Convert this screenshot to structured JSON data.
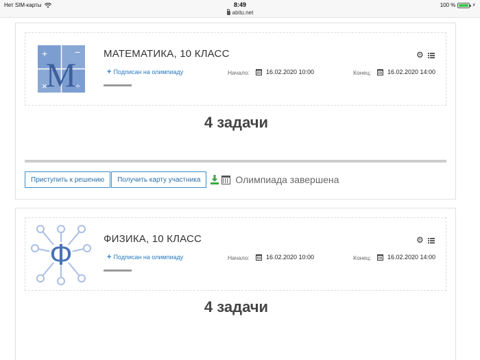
{
  "status_bar": {
    "carrier": "Нет SIM-карты",
    "time": "8:49",
    "url": "abitu.net",
    "battery": "100 %",
    "battery_level": 1.0
  },
  "olympiads": [
    {
      "title": "МАТЕМАТИКА, 10 КЛАСС",
      "subscribed": "Подписан на олимпиаду",
      "start_label": "Начало:",
      "start_value": "16.02.2020 10:00",
      "end_label": "Конец:",
      "end_value": "16.02.2020 14:00",
      "tasks": "4 задачи",
      "thumb_letter": "M",
      "start_button": "Приступить к решению",
      "card_button": "Получить карту участника",
      "status": "Олимпиада завершена"
    },
    {
      "title": "ФИЗИКА, 10 КЛАСС",
      "subscribed": "Подписан на олимпиаду",
      "start_label": "Начало:",
      "start_value": "16.02.2020 10:00",
      "end_label": "Конец:",
      "end_value": "16.02.2020 14:00",
      "tasks": "4 задачи",
      "thumb_letter": "Ф"
    }
  ],
  "colors": {
    "link": "#2a7bbf",
    "button_border": "#3a8cc9",
    "math_thumb": "#7fa0d0",
    "physics_thumb": "#a9bfe3",
    "download_icon": "#3aa845"
  },
  "icons": [
    "wifi-icon",
    "lock-icon",
    "battery-icon",
    "plus-icon",
    "calendar-icon",
    "gear-icon",
    "list-icon",
    "download-icon"
  ]
}
